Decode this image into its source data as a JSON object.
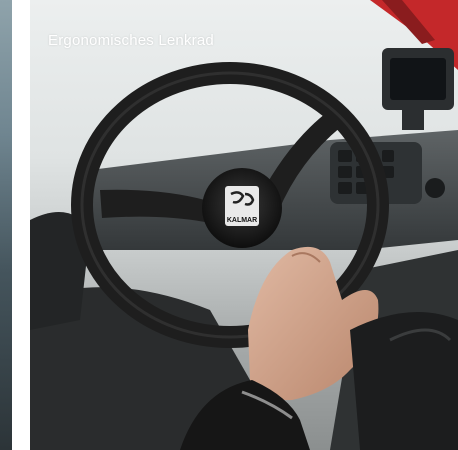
{
  "caption": "Ergonomisches Lenkrad",
  "logo_text": "KALMAR",
  "colors": {
    "cab_red": "#c4282a",
    "wheel_black": "#1e1e1e",
    "dashboard_grey": "#505456",
    "sky_white": "#ecefef"
  }
}
